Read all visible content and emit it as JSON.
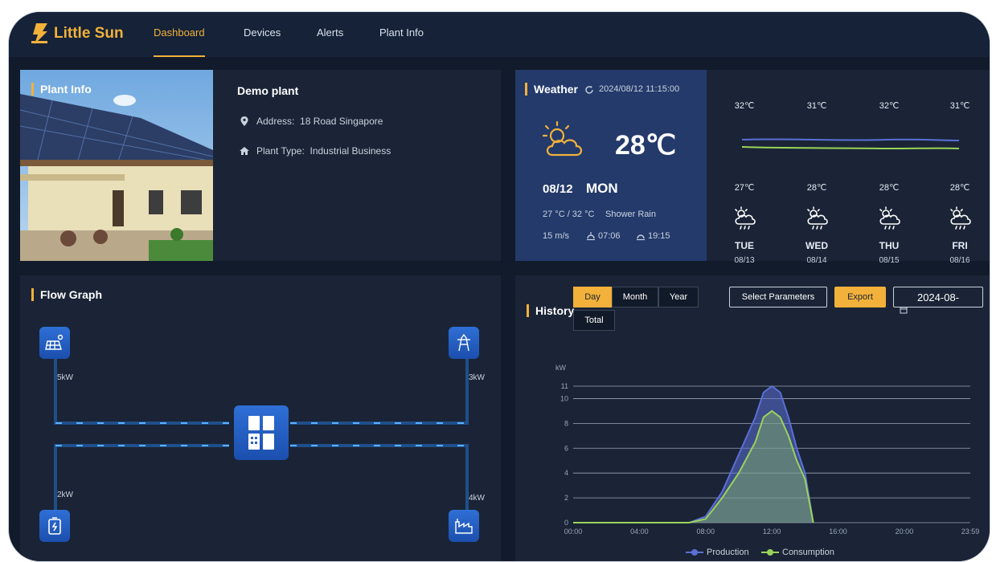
{
  "app": {
    "name": "Little Sun"
  },
  "nav": {
    "items": [
      "Dashboard",
      "Devices",
      "Alerts",
      "Plant Info"
    ],
    "active": "Dashboard"
  },
  "plant_info": {
    "title": "Plant Info",
    "name": "Demo plant",
    "address_label": "Address:",
    "address": "18 Road Singapore",
    "type_label": "Plant Type:",
    "type": "Industrial Business"
  },
  "weather": {
    "title": "Weather",
    "timestamp": "2024/08/12 11:15:00",
    "current_temp": "28℃",
    "date": "08/12",
    "weekday": "MON",
    "range": "27 °C / 32 °C",
    "condition": "Shower Rain",
    "wind": "15 m/s",
    "sunrise": "07:06",
    "sunset": "19:15",
    "forecast": [
      {
        "high": "32℃",
        "low": "27℃",
        "day": "TUE",
        "date": "08/13"
      },
      {
        "high": "31℃",
        "low": "28℃",
        "day": "WED",
        "date": "08/14"
      },
      {
        "high": "32℃",
        "low": "28℃",
        "day": "THU",
        "date": "08/15"
      },
      {
        "high": "31℃",
        "low": "28℃",
        "day": "FRI",
        "date": "08/16"
      }
    ]
  },
  "flow_graph": {
    "title": "Flow Graph",
    "solar_label": "5kW",
    "grid_label": "3kW",
    "battery_label": "2kW",
    "load_label": "4kW"
  },
  "history": {
    "title": "History",
    "tabs": [
      "Day",
      "Month",
      "Year",
      "Total"
    ],
    "active_tab": "Day",
    "select_params": "Select Parameters",
    "export": "Export",
    "date_value": "2024-08-",
    "colors": {
      "production": "#5b6fd6",
      "consumption": "#9bd35a"
    }
  },
  "chart_data": {
    "type": "area",
    "ylabel": "kW",
    "ylim": [
      0,
      11
    ],
    "yticks": [
      0,
      2,
      4,
      6,
      8,
      10,
      11
    ],
    "xticks": [
      "00:00",
      "04:00",
      "08:00",
      "12:00",
      "16:00",
      "20:00",
      "23:59"
    ],
    "x": [
      "00:00",
      "06:00",
      "07:00",
      "08:00",
      "09:00",
      "10:00",
      "11:00",
      "11:30",
      "12:00",
      "12:30",
      "13:00",
      "13:30",
      "14:00",
      "14:30"
    ],
    "series": [
      {
        "name": "Production",
        "values": [
          0,
          0,
          0,
          0.5,
          2.5,
          5.5,
          8.5,
          10.5,
          11,
          10.5,
          8.5,
          6,
          4,
          0
        ]
      },
      {
        "name": "Consumption",
        "values": [
          0,
          0,
          0,
          0.3,
          2,
          4,
          6.5,
          8.5,
          9,
          8.5,
          7,
          5,
          3.5,
          0
        ]
      }
    ],
    "grid": true,
    "legend": "bottom"
  }
}
